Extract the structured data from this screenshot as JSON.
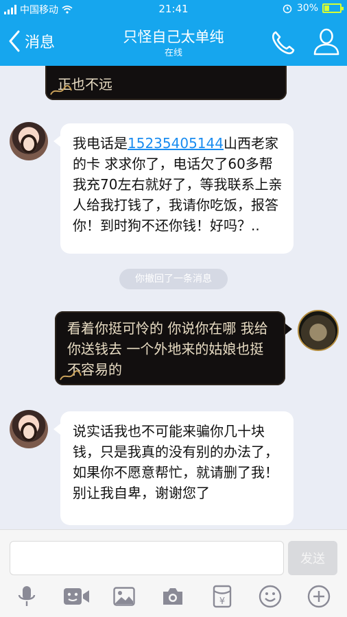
{
  "status_bar": {
    "carrier": "中国移动",
    "time": "21:41",
    "battery_percent": "30%",
    "battery_level": 0.3
  },
  "nav": {
    "back_label": "消息",
    "title": "只怪自己太单纯",
    "subtitle": "在线"
  },
  "messages": {
    "top_partial": {
      "text": "正也不远"
    },
    "msg1": {
      "prefix": "我电话是",
      "phone": "15235405144",
      "suffix": "山西老家的卡 求求你了，电话欠了60多帮我充70左右就好了，等我联系上亲人给我打钱了，我请你吃饭，报答你！到时狗不还你钱！好吗？.."
    },
    "system_notice": "你撤回了一条消息",
    "msg2": {
      "text": "看着你挺可怜的 你说你在哪 我给你送钱去 一个外地来的姑娘也挺不容易的"
    },
    "msg3": {
      "text": "说实话我也不可能来骗你几十块钱，只是我真的没有别的办法了，如果你不愿意帮忙，就请删了我！别让我自卑，谢谢您了"
    }
  },
  "input": {
    "send_label": "发送"
  },
  "toolbar": {
    "icons": [
      "microphone-icon",
      "video-call-icon",
      "image-icon",
      "camera-icon",
      "red-packet-icon",
      "emoji-icon",
      "plus-icon"
    ]
  },
  "colors": {
    "header": "#16a6ee",
    "chat_bg": "#eaedf5",
    "dark_bubble": "#120f0f",
    "dark_bubble_text": "#e8dcc3",
    "link": "#1a8cf0"
  }
}
